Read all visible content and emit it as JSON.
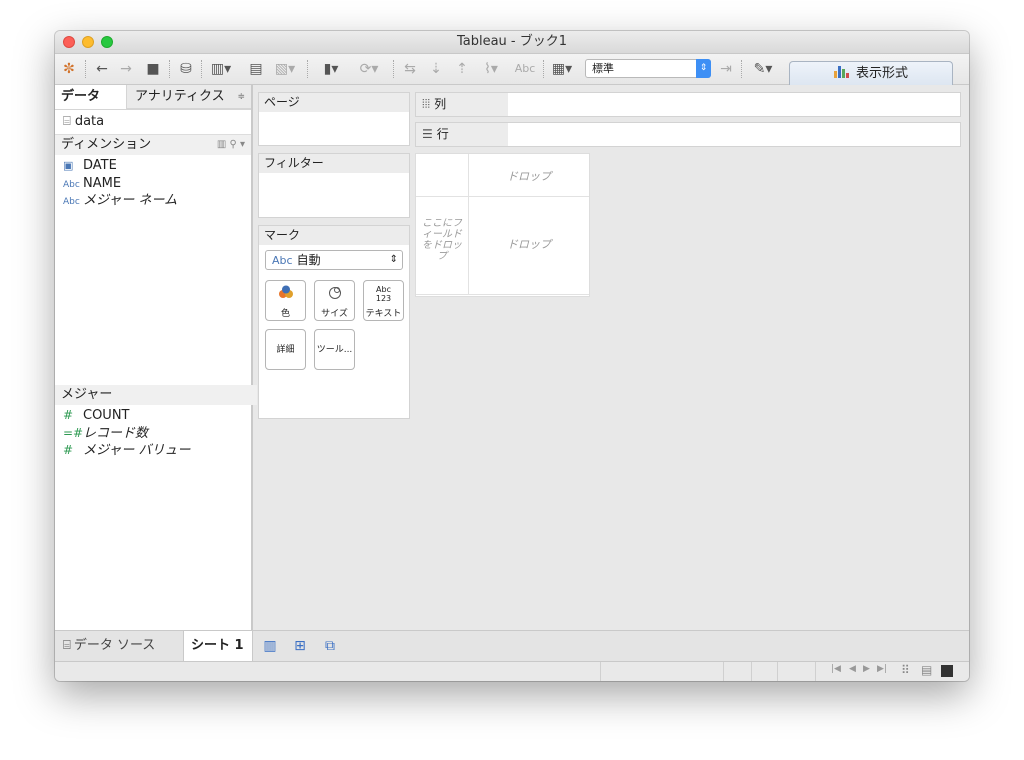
{
  "window": {
    "title": "Tableau - ブック1"
  },
  "toolbar": {
    "fit_value": "標準",
    "show_me_label": "表示形式",
    "abc_label": "Abc"
  },
  "data_pane": {
    "tab_data": "データ",
    "tab_analytics": "アナリティクス",
    "datasource": "data",
    "dimensions_header": "ディメンション",
    "dimensions": [
      {
        "icon": "calendar-icon",
        "type_label": "",
        "name": "DATE"
      },
      {
        "icon": "abc-icon",
        "type_label": "Abc",
        "name": "NAME"
      },
      {
        "icon": "abc-icon",
        "type_label": "Abc",
        "name": "メジャー ネーム"
      }
    ],
    "measures_header": "メジャー",
    "measures": [
      {
        "icon": "hash-icon",
        "name": "COUNT"
      },
      {
        "icon": "hash-icon",
        "name": "レコード数"
      },
      {
        "icon": "hash-icon",
        "name": "メジャー バリュー"
      }
    ]
  },
  "pages": {
    "title": "ページ"
  },
  "filters": {
    "title": "フィルター"
  },
  "marks": {
    "title": "マーク",
    "type_prefix": "Abc",
    "type": "自動",
    "color_label": "色",
    "size_label": "サイズ",
    "text_label": "テキスト",
    "text_icon_top": "Abc",
    "text_icon_bottom": "123",
    "detail_label": "詳細",
    "tooltip_label": "ツール..."
  },
  "shelves": {
    "columns": "列",
    "rows": "行"
  },
  "canvas": {
    "drop_top": "ドロップ",
    "drop_main": "ドロップ",
    "drop_field_line1": "ここにフ",
    "drop_field_line2": "ィールド",
    "drop_field_line3": "をドロッ",
    "drop_field_line4": "プ"
  },
  "bottom_tabs": {
    "datasource": "データ ソース",
    "sheet": "シート 1"
  }
}
